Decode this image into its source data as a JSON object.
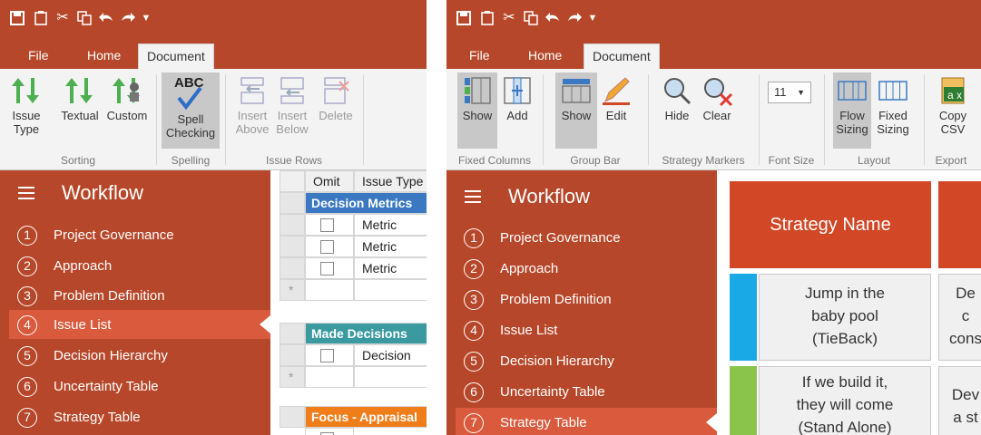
{
  "left": {
    "tabs": [
      "File",
      "Home",
      "Document"
    ],
    "active_tab": "Document",
    "ribbon": {
      "buttons": [
        {
          "label": "Issue\nType",
          "icon": "sort-arrows-icon"
        },
        {
          "label": "Textual",
          "icon": "sort-arrows-icon"
        },
        {
          "label": "Custom",
          "icon": "sort-custom-icon"
        },
        {
          "label": "Spell\nChecking",
          "icon": "spell-check-icon"
        },
        {
          "label": "Insert\nAbove",
          "icon": "insert-above-icon"
        },
        {
          "label": "Insert\nBelow",
          "icon": "insert-below-icon"
        },
        {
          "label": "Delete",
          "icon": "delete-row-icon"
        }
      ],
      "groups": [
        "Sorting",
        "Spelling",
        "Issue Rows"
      ],
      "spell_text": "ABC"
    },
    "grid": {
      "columns": [
        "Omit",
        "Issue Type"
      ],
      "groups": [
        {
          "name": "Decision Metrics",
          "color": "#3a78c2",
          "rows": [
            "Metric",
            "Metric",
            "Metric"
          ]
        },
        {
          "name": "Made Decisions",
          "color": "#3a9aa0",
          "rows": [
            "Decision"
          ]
        },
        {
          "name": "Focus - Appraisal",
          "color": "#ee7d1a",
          "rows": []
        }
      ],
      "new_row_marker": "*"
    }
  },
  "right": {
    "tabs": [
      "File",
      "Home",
      "Document"
    ],
    "active_tab": "Document",
    "ribbon": {
      "buttons": [
        {
          "label": "Show",
          "icon": "fixed-columns-show-icon"
        },
        {
          "label": "Add",
          "icon": "add-column-icon"
        },
        {
          "label": "Show",
          "icon": "group-bar-show-icon"
        },
        {
          "label": "Edit",
          "icon": "pencil-icon"
        },
        {
          "label": "Hide",
          "icon": "hide-markers-icon"
        },
        {
          "label": "Clear",
          "icon": "clear-markers-icon"
        },
        {
          "label": "Flow\nSizing",
          "icon": "flow-sizing-icon"
        },
        {
          "label": "Fixed\nSizing",
          "icon": "fixed-sizing-icon"
        },
        {
          "label": "Copy\nCSV",
          "icon": "excel-copy-icon"
        }
      ],
      "font_size": "11",
      "groups": [
        "Fixed Columns",
        "Group Bar",
        "Strategy Markers",
        "Font Size",
        "Layout",
        "Export"
      ]
    },
    "table": {
      "header": "Strategy Name",
      "rows": [
        {
          "text": "Jump in the\nbaby pool\n(TieBack)",
          "color": "#19a9e6",
          "next": "De\nc\ncons"
        },
        {
          "text": "If we build it,\nthey will come\n(Stand Alone)",
          "color": "#8ac44a",
          "next": "Dev\na st"
        }
      ]
    }
  },
  "workflow": {
    "title": "Workflow",
    "items": [
      {
        "num": "1",
        "label": "Project Governance"
      },
      {
        "num": "2",
        "label": "Approach"
      },
      {
        "num": "3",
        "label": "Problem Definition"
      },
      {
        "num": "4",
        "label": "Issue List"
      },
      {
        "num": "5",
        "label": "Decision Hierarchy"
      },
      {
        "num": "6",
        "label": "Uncertainty Table"
      },
      {
        "num": "7",
        "label": "Strategy Table"
      }
    ],
    "left_active": "Issue List",
    "right_active": "Strategy Table"
  },
  "colors": {
    "accent": "#b7472a",
    "active_item": "#d95a3c",
    "strategy_header": "#d24726"
  }
}
